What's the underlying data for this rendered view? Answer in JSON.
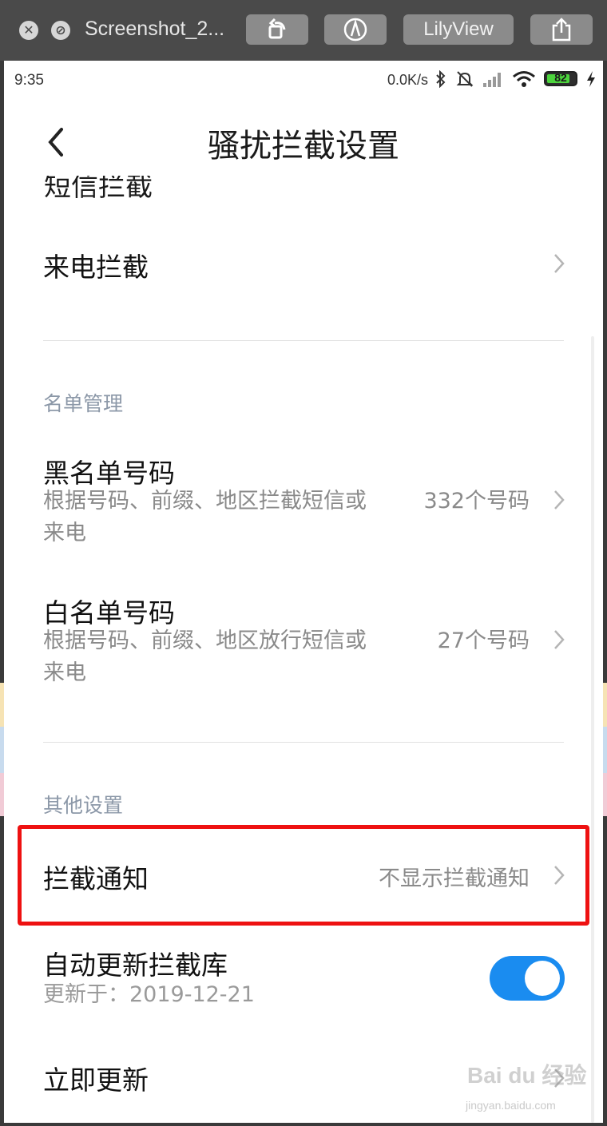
{
  "window": {
    "title": "Screenshot_2...",
    "app_button_label": "LilyView"
  },
  "status_bar": {
    "time": "9:35",
    "network_speed": "0.0K/s",
    "battery_level": "82",
    "battery_fraction": 0.82
  },
  "header": {
    "title": "骚扰拦截设置"
  },
  "partial_row": {
    "label": "短信拦截"
  },
  "call_block": {
    "label": "来电拦截"
  },
  "list_section": {
    "header": "名单管理",
    "blacklist": {
      "label": "黑名单号码",
      "desc_line1": "根据号码、前缀、地区拦截短信或",
      "desc_line2": "来电",
      "count": "332个号码"
    },
    "whitelist": {
      "label": "白名单号码",
      "desc_line1": "根据号码、前缀、地区放行短信或",
      "desc_line2": "来电",
      "count": "27个号码"
    }
  },
  "other_section": {
    "header": "其他设置",
    "notify": {
      "label": "拦截通知",
      "value": "不显示拦截通知"
    },
    "auto_update": {
      "label": "自动更新拦截库",
      "updated": "更新于：2019-12-21",
      "enabled": true
    },
    "update_now": {
      "label": "立即更新"
    }
  },
  "watermark": {
    "brand": "Bai du 经验",
    "url": "jingyan.baidu.com"
  },
  "colors": {
    "accent": "#1a8cf0",
    "highlight": "#ee1111",
    "section_header": "#8c98a8"
  }
}
